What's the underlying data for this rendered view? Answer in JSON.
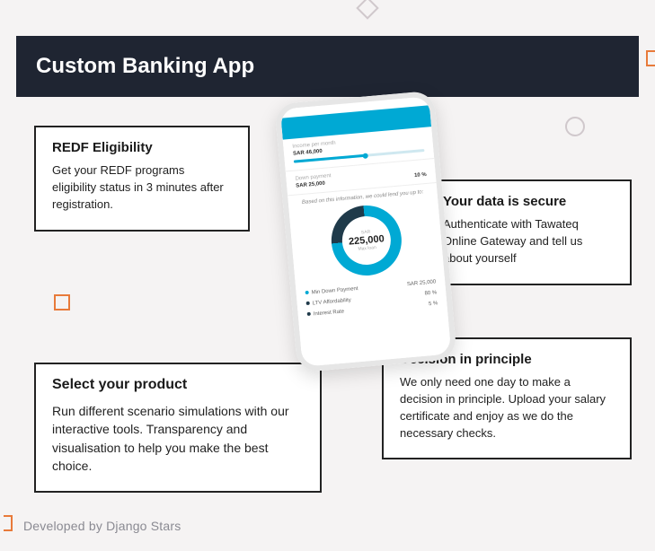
{
  "title": "Custom Banking App",
  "cards": {
    "redf": {
      "heading": "REDF Eligibility",
      "body": "Get your REDF programs eligibility status in 3 minutes after registration."
    },
    "secure": {
      "heading": "Your data is secure",
      "body": "Authenticate with Tawateq Online Gateway and tell us about yourself"
    },
    "select": {
      "heading": "Select your product",
      "body": "Run different scenario simulations with our interactive tools. Transparency and visualisation to help you make the best choice."
    },
    "decision": {
      "heading": "Decision in principle",
      "body": "We only need one day to make a decision in principle. Upload your salary certificate and enjoy as we do the necessary checks."
    }
  },
  "phone": {
    "income_label": "Income per month",
    "income_value": "SAR 46,000",
    "down_label": "Down payment",
    "down_value": "SAR 25,000",
    "down_pct": "10 %",
    "lend_text": "Based on this information, we could lend you up to:",
    "donut": {
      "currency": "SAR",
      "amount": "225,000",
      "sub": "Max loan"
    },
    "rows": [
      {
        "dot": "blue",
        "label": "Min Down Payment",
        "value": "SAR 25,000"
      },
      {
        "dot": "dark",
        "label": "LTV Affordability",
        "value": "80 %"
      },
      {
        "dot": "dark",
        "label": "Interest Rate",
        "value": "5 %"
      }
    ]
  },
  "footer": "Developed by Django Stars"
}
